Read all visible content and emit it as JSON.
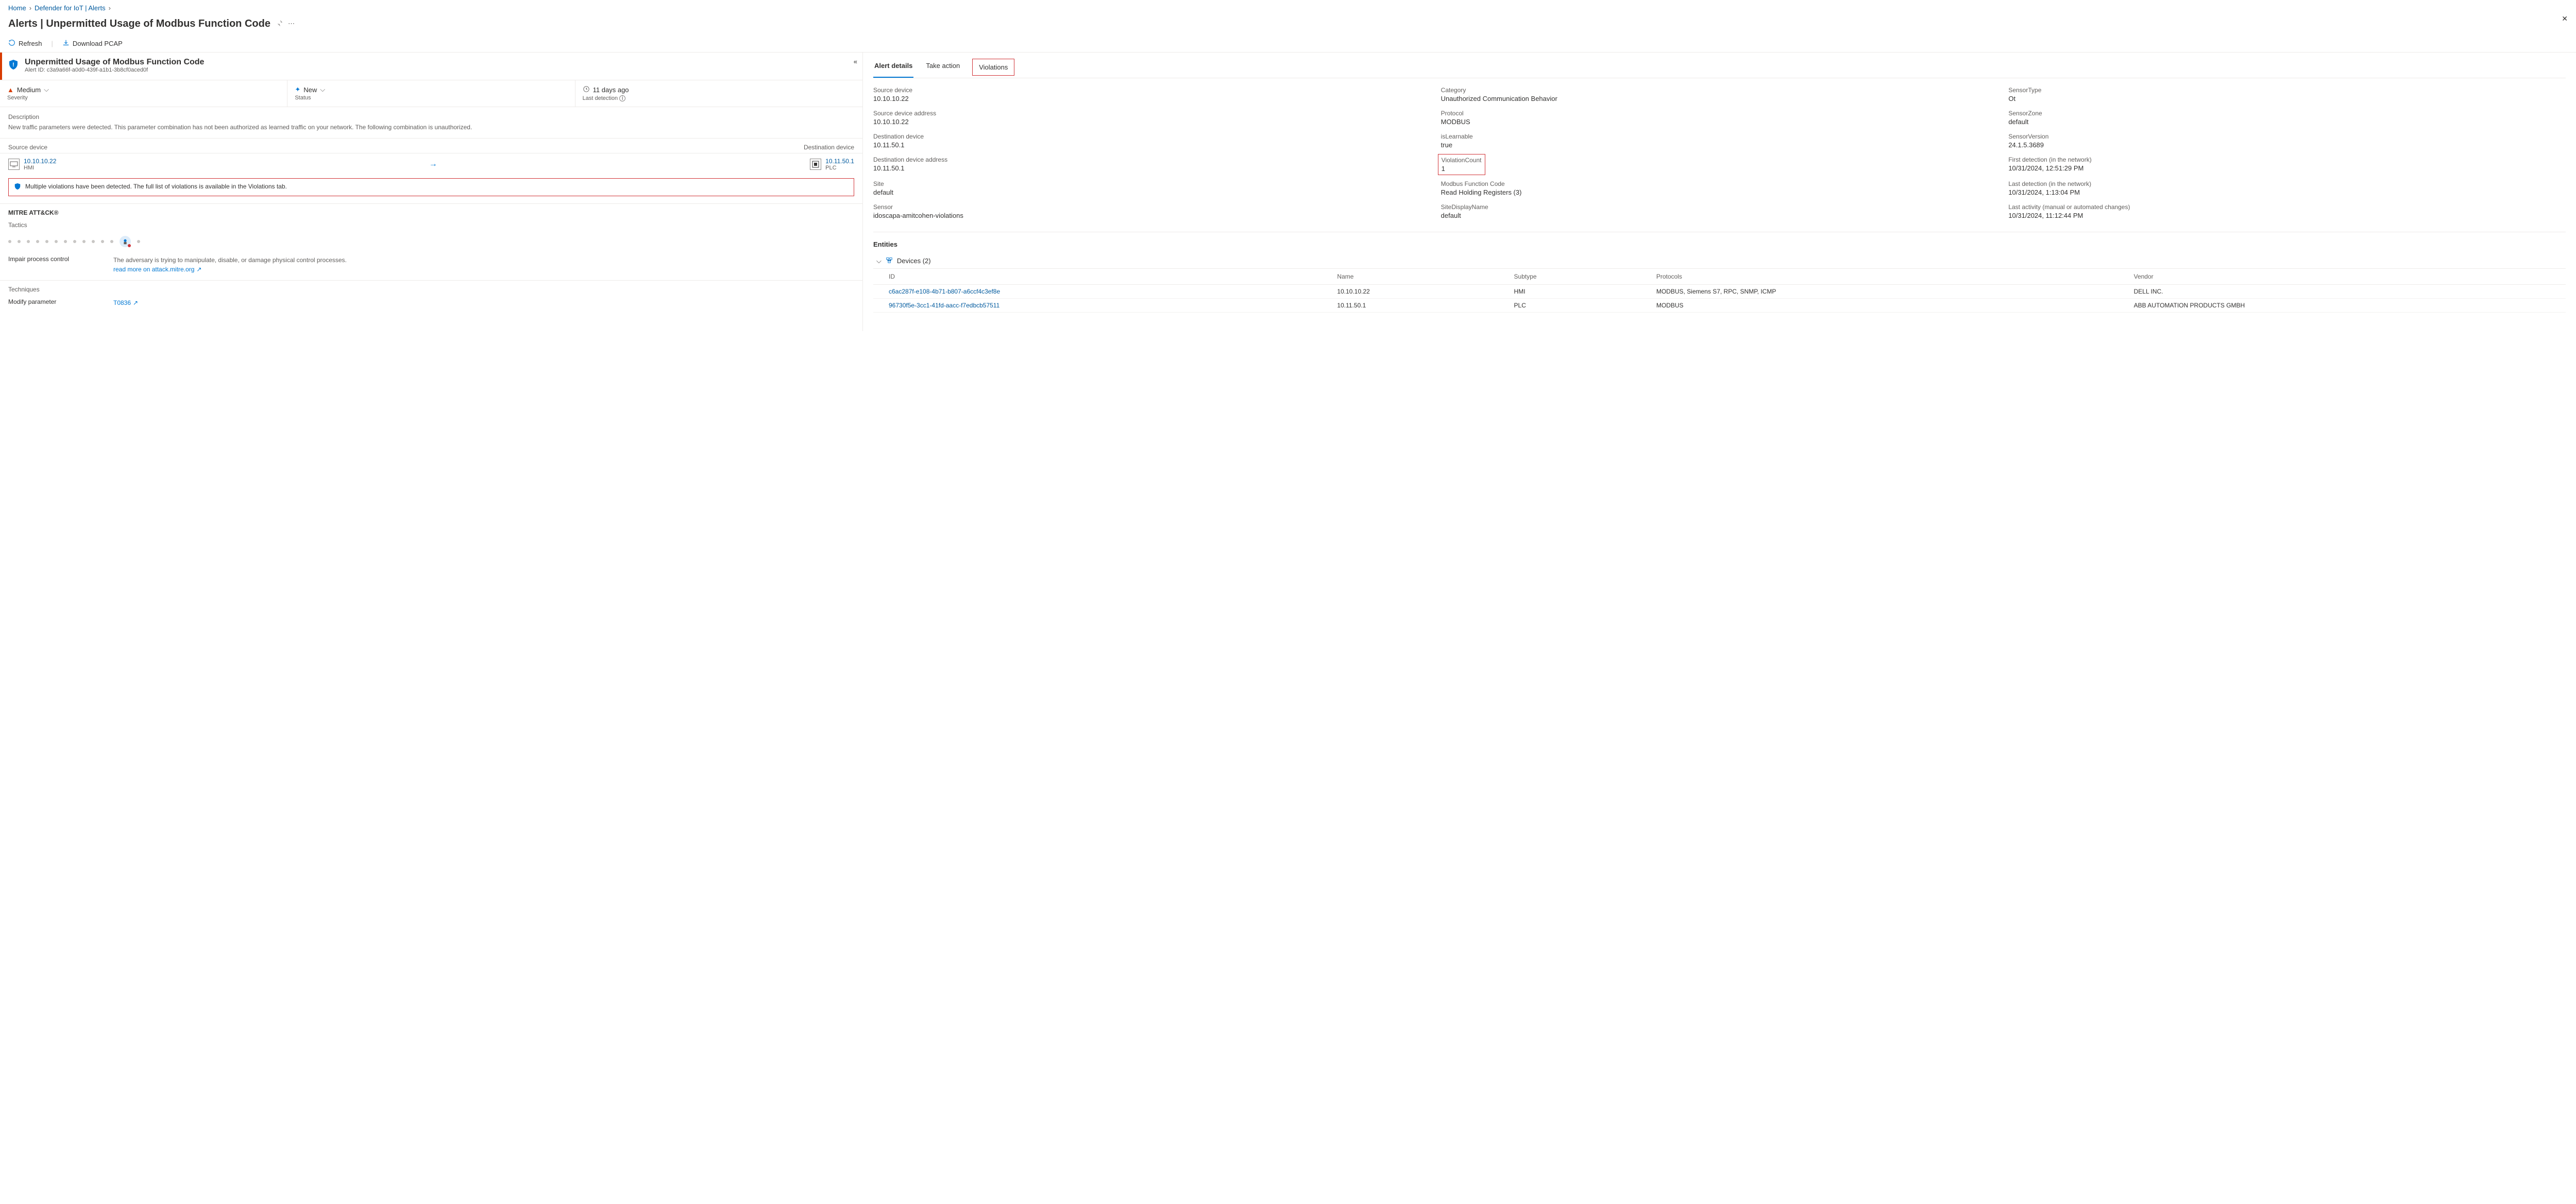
{
  "breadcrumb": [
    "Home",
    "Defender for IoT | Alerts"
  ],
  "page_title": "Alerts | Unpermitted Usage of Modbus Function Code",
  "toolbar": {
    "refresh": "Refresh",
    "download": "Download PCAP"
  },
  "alert": {
    "title": "Unpermitted Usage of Modbus Function Code",
    "id_label": "Alert ID: c3a9a66f-a0d0-439f-a1b1-3b8cf0aced0f",
    "severity": {
      "value": "Medium",
      "label": "Severity"
    },
    "status": {
      "value": "New",
      "label": "Status"
    },
    "last_detection": {
      "value": "11 days ago",
      "label": "Last detection"
    },
    "description_label": "Description",
    "description": "New traffic parameters were detected. This parameter combination has not been authorized as learned traffic on your network. The following combination is unauthorized."
  },
  "devices": {
    "src_label": "Source device",
    "dst_label": "Destination device",
    "src": {
      "ip": "10.10.10.22",
      "type": "HMI"
    },
    "dst": {
      "ip": "10.11.50.1",
      "type": "PLC"
    }
  },
  "callout": "Multiple violations have been detected. The full list of violations is available in the Violations tab.",
  "mitre": {
    "title": "MITRE ATT&CK®",
    "tactics_label": "Tactics",
    "impair": {
      "name": "Impair process control",
      "desc": "The adversary is trying to manipulate, disable, or damage physical control processes.",
      "link": "read more on attack.mitre.org"
    },
    "techniques_label": "Techniques",
    "technique": {
      "name": "Modify parameter",
      "id": "T0836"
    }
  },
  "tabs": {
    "details": "Alert details",
    "take": "Take action",
    "violations": "Violations"
  },
  "details": [
    {
      "k": "Source device",
      "v": "10.10.10.22"
    },
    {
      "k": "Category",
      "v": "Unauthorized Communication Behavior"
    },
    {
      "k": "SensorType",
      "v": "Ot"
    },
    {
      "k": "Source device address",
      "v": "10.10.10.22"
    },
    {
      "k": "Protocol",
      "v": "MODBUS"
    },
    {
      "k": "SensorZone",
      "v": "default"
    },
    {
      "k": "Destination device",
      "v": "10.11.50.1"
    },
    {
      "k": "isLearnable",
      "v": "true"
    },
    {
      "k": "SensorVersion",
      "v": "24.1.5.3689"
    },
    {
      "k": "Destination device address",
      "v": "10.11.50.1"
    },
    {
      "k": "ViolationCount",
      "v": "1",
      "boxed": true
    },
    {
      "k": "First detection (in the network)",
      "v": "10/31/2024, 12:51:29 PM"
    },
    {
      "k": "Site",
      "v": "default"
    },
    {
      "k": "Modbus Function Code",
      "v": "Read Holding Registers (3)"
    },
    {
      "k": "Last detection (in the network)",
      "v": "10/31/2024, 1:13:04 PM"
    },
    {
      "k": "Sensor",
      "v": "idoscapa-amitcohen-violations"
    },
    {
      "k": "SiteDisplayName",
      "v": "default"
    },
    {
      "k": "Last activity (manual or automated changes)",
      "v": "10/31/2024, 11:12:44 PM"
    }
  ],
  "entities": {
    "title": "Entities",
    "group": "Devices (2)",
    "cols": [
      "ID",
      "Name",
      "Subtype",
      "Protocols",
      "Vendor"
    ],
    "rows": [
      {
        "id": "c6ac287f-e108-4b71-b807-a6ccf4c3ef8e",
        "name": "10.10.10.22",
        "subtype": "HMI",
        "protocols": "MODBUS, Siemens S7, RPC, SNMP, ICMP",
        "vendor": "DELL INC."
      },
      {
        "id": "96730f5e-3cc1-41fd-aacc-f7edbcb57511",
        "name": "10.11.50.1",
        "subtype": "PLC",
        "protocols": "MODBUS",
        "vendor": "ABB AUTOMATION PRODUCTS GMBH"
      }
    ]
  }
}
